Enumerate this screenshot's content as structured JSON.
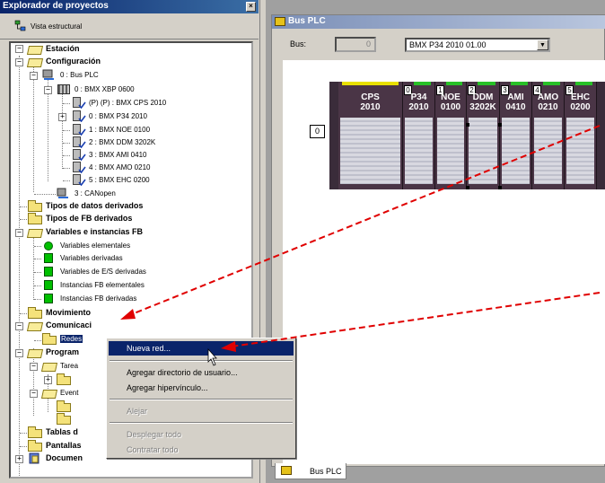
{
  "explorer": {
    "title": "Explorador de proyectos",
    "close_glyph": "×",
    "view_label": "Vista estructural"
  },
  "tree": {
    "station": "Estación",
    "configuration": "Configuración",
    "bus_plc": "0 : Bus PLC",
    "rack": "0 : BMX XBP 0600",
    "slot_p": "(P) (P) : BMX CPS 2010",
    "slot_0": "0 : BMX P34 2010",
    "slot_1": "1 : BMX NOE 0100",
    "slot_2": "2 : BMX DDM 3202K",
    "slot_3": "3 : BMX AMI 0410",
    "slot_4": "4 : BMX AMO 0210",
    "slot_5": "5 : BMX EHC 0200",
    "canopen": "3 : CANopen",
    "dtypes": "Tipos de datos derivados",
    "fbtypes": "Tipos de FB derivados",
    "vars": "Variables e instancias FB",
    "v_elem": "Variables elementales",
    "v_deriv": "Variables derivadas",
    "v_es": "Variables de E/S derivadas",
    "fb_elem": "Instancias FB elementales",
    "fb_deriv": "Instancias FB derivadas",
    "movement": "Movimiento",
    "comm": "Comunicaci",
    "networks": "Redes",
    "program": "Program",
    "tasks": "Tarea",
    "events": "Event",
    "tables": "Tablas d",
    "screens": "Pantallas",
    "docs": "Documen",
    "toggle_minus": "−",
    "toggle_plus": "+"
  },
  "bus_window": {
    "title": "Bus PLC",
    "bus_label": "Bus:",
    "bus_number": "0",
    "cpu_value": "BMX P34 2010  01.00",
    "dropdown_glyph": "▼",
    "rack_number": "0",
    "tab_label": "Bus PLC"
  },
  "rack_slots": [
    {
      "num": "",
      "l1": "CPS",
      "l2": "2010"
    },
    {
      "num": "0",
      "l1": "P34",
      "l2": "2010"
    },
    {
      "num": "1",
      "l1": "NOE",
      "l2": "0100"
    },
    {
      "num": "2",
      "l1": "DDM",
      "l2": "3202K"
    },
    {
      "num": "3",
      "l1": "AMI",
      "l2": "0410"
    },
    {
      "num": "4",
      "l1": "AMO",
      "l2": "0210"
    },
    {
      "num": "5",
      "l1": "EHC",
      "l2": "0200"
    }
  ],
  "context_menu": {
    "new_network": "Nueva red...",
    "add_user_dir": "Agregar directorio de usuario...",
    "add_hyperlink": "Agregar hipervínculo...",
    "zoom_out": "Alejar",
    "expand_all": "Desplegar todo",
    "collapse_all": "Contratar todo"
  },
  "colors": {
    "titlebar": "#0a246a",
    "menu_highlight": "#0a246a",
    "arrow": "#e00000"
  }
}
